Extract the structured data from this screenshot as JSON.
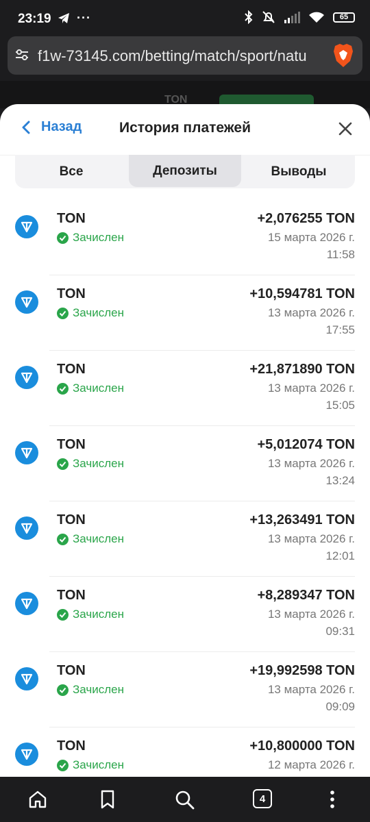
{
  "statusbar": {
    "time": "23:19",
    "battery": "65"
  },
  "browser": {
    "url": "f1w-73145.com/betting/match/sport/natu",
    "tab_count": "4"
  },
  "background": {
    "currency": "TON"
  },
  "sheet": {
    "back_label": "Назад",
    "title": "История платежей",
    "tabs": [
      "Все",
      "Депозиты",
      "Выводы"
    ],
    "active_tab": "Депозиты"
  },
  "transactions": [
    {
      "name": "TON",
      "status": "Зачислен",
      "amount": "+2,076255 TON",
      "date": "15 марта 2026 г.",
      "time": "11:58"
    },
    {
      "name": "TON",
      "status": "Зачислен",
      "amount": "+10,594781 TON",
      "date": "13 марта 2026 г.",
      "time": "17:55"
    },
    {
      "name": "TON",
      "status": "Зачислен",
      "amount": "+21,871890 TON",
      "date": "13 марта 2026 г.",
      "time": "15:05"
    },
    {
      "name": "TON",
      "status": "Зачислен",
      "amount": "+5,012074 TON",
      "date": "13 марта 2026 г.",
      "time": "13:24"
    },
    {
      "name": "TON",
      "status": "Зачислен",
      "amount": "+13,263491 TON",
      "date": "13 марта 2026 г.",
      "time": "12:01"
    },
    {
      "name": "TON",
      "status": "Зачислен",
      "amount": "+8,289347 TON",
      "date": "13 марта 2026 г.",
      "time": "09:31"
    },
    {
      "name": "TON",
      "status": "Зачислен",
      "amount": "+19,992598 TON",
      "date": "13 марта 2026 г.",
      "time": "09:09"
    },
    {
      "name": "TON",
      "status": "Зачислен",
      "amount": "+10,800000 TON",
      "date": "12 марта 2026 г.",
      "time": ""
    }
  ],
  "colors": {
    "accent": "#2a7fd4",
    "success": "#2aa54a",
    "ton": "#1a8ddd"
  }
}
